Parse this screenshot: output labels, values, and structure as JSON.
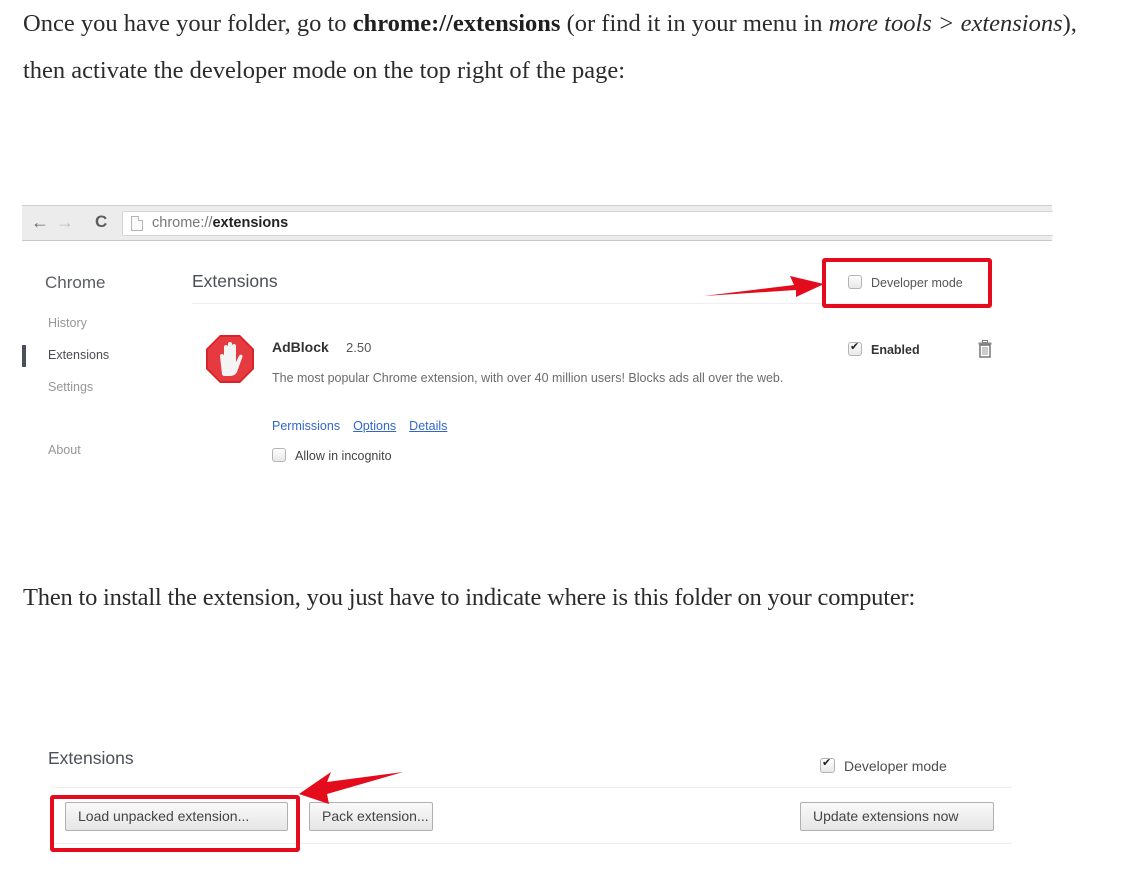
{
  "article": {
    "paragraph1": {
      "text_before": "Once you have your folder, go to ",
      "bold": "chrome://extensions",
      "text_mid": " (or find it in your menu in ",
      "italic": "more tools > extensions",
      "text_after": "), then activate the developer mode on the top right of the page:"
    },
    "paragraph2": "Then to install the extension, you just have to indicate where is this folder on your computer:"
  },
  "screenshot1": {
    "toolbar": {
      "back_icon": "←",
      "forward_icon": "→",
      "reload_icon": "C",
      "url_prefix": "chrome://",
      "url_host": "extensions"
    },
    "sidebar": {
      "title": "Chrome",
      "items": [
        {
          "label": "History",
          "active": false
        },
        {
          "label": "Extensions",
          "active": true
        },
        {
          "label": "Settings",
          "active": false
        },
        {
          "label": "About",
          "active": false
        }
      ]
    },
    "main": {
      "title": "Extensions",
      "developer_mode": {
        "label": "Developer mode",
        "checked": false
      },
      "extension": {
        "name": "AdBlock",
        "version": "2.50",
        "description": "The most popular Chrome extension, with over 40 million users! Blocks ads all over the web.",
        "links": [
          "Permissions",
          "Options",
          "Details"
        ],
        "incognito_label": "Allow in incognito",
        "incognito_checked": false,
        "enabled_label": "Enabled",
        "enabled_checked": true
      }
    },
    "annotation_color": "#e30b1c"
  },
  "screenshot2": {
    "title": "Extensions",
    "developer_mode": {
      "label": "Developer mode",
      "checked": true
    },
    "buttons": {
      "load_unpacked": "Load unpacked extension...",
      "pack": "Pack extension...",
      "update": "Update extensions now"
    },
    "annotation_color": "#e30b1c"
  }
}
